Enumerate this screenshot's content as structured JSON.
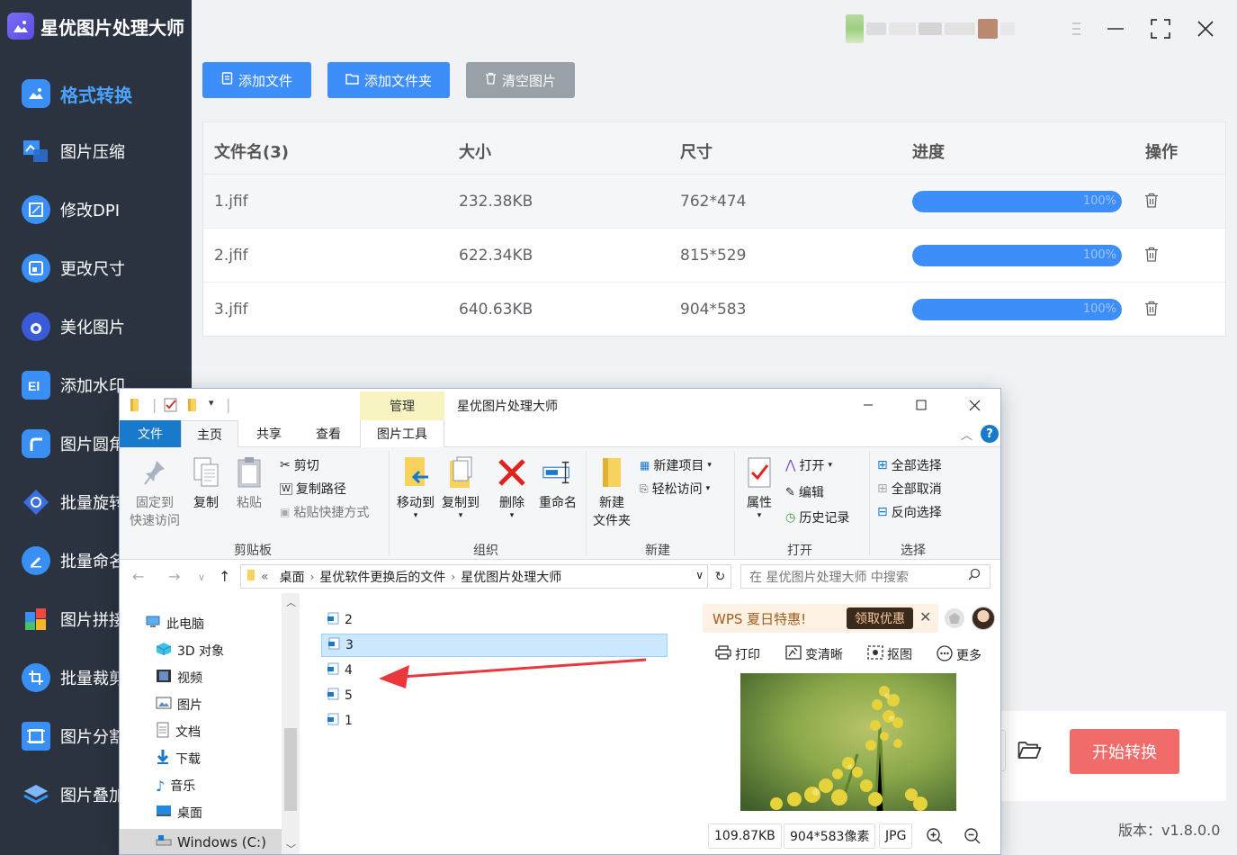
{
  "app": {
    "title": "星优图片处理大师",
    "version": "版本：v1.8.0.0",
    "start_label": "开始转换",
    "accent": "#3d8ef8",
    "start_color": "#f26b6b"
  },
  "sidebar": {
    "items": [
      {
        "label": "格式转换",
        "active": true
      },
      {
        "label": "图片压缩"
      },
      {
        "label": "修改DPI"
      },
      {
        "label": "更改尺寸"
      },
      {
        "label": "美化图片"
      },
      {
        "label": "添加水印"
      },
      {
        "label": "图片圆角"
      },
      {
        "label": "批量旋转"
      },
      {
        "label": "批量命名"
      },
      {
        "label": "图片拼接"
      },
      {
        "label": "批量裁剪"
      },
      {
        "label": "图片分割"
      },
      {
        "label": "图片叠加"
      }
    ]
  },
  "toolbar": {
    "add_file": "添加文件",
    "add_folder": "添加文件夹",
    "clear": "清空图片"
  },
  "table": {
    "headers": {
      "name": "文件名(3)",
      "size": "大小",
      "dims": "尺寸",
      "progress": "进度",
      "action": "操作"
    },
    "rows": [
      {
        "name": "1.jfif",
        "size": "232.38KB",
        "dims": "762*474",
        "progress": "100%",
        "progress_value": 1.0
      },
      {
        "name": "2.jfif",
        "size": "622.34KB",
        "dims": "815*529",
        "progress": "100%",
        "progress_value": 1.0
      },
      {
        "name": "3.jfif",
        "size": "640.63KB",
        "dims": "904*583",
        "progress": "100%",
        "progress_value": 1.0
      }
    ]
  },
  "explorer": {
    "title": "星优图片处理大师",
    "manage_tab": "管理",
    "tabs": {
      "file": "文件",
      "home": "主页",
      "share": "共享",
      "view": "查看",
      "picture_tools": "图片工具"
    },
    "ribbon": {
      "pin": [
        "固定到",
        "快速访问"
      ],
      "copy": "复制",
      "paste": "粘贴",
      "cut": "剪切",
      "copy_path": "复制路径",
      "paste_shortcut": "粘贴快捷方式",
      "clipboard": "剪贴板",
      "move_to": "移动到",
      "copy_to": "复制到",
      "delete": "删除",
      "rename": "重命名",
      "organize": "组织",
      "new_folder": [
        "新建",
        "文件夹"
      ],
      "new_item": "新建项目",
      "easy_access": "轻松访问",
      "new_group": "新建",
      "properties": "属性",
      "open": "打开",
      "edit": "编辑",
      "history": "历史记录",
      "open_group": "打开",
      "select_all": "全部选择",
      "select_none": "全部取消",
      "invert": "反向选择",
      "select_group": "选择"
    },
    "address": {
      "prefix": "«",
      "crumbs": [
        "桌面",
        "星优软件更换后的文件",
        "星优图片处理大师"
      ],
      "search_placeholder": "在 星优图片处理大师 中搜索"
    },
    "tree": [
      {
        "label": "此电脑",
        "icon": "computer-icon"
      },
      {
        "label": "3D 对象",
        "icon": "3d-objects-icon"
      },
      {
        "label": "视频",
        "icon": "video-icon"
      },
      {
        "label": "图片",
        "icon": "pictures-icon"
      },
      {
        "label": "文档",
        "icon": "documents-icon"
      },
      {
        "label": "下载",
        "icon": "download-icon"
      },
      {
        "label": "音乐",
        "icon": "music-icon"
      },
      {
        "label": "桌面",
        "icon": "desktop-icon"
      },
      {
        "label": "Windows (C:)",
        "icon": "drive-icon"
      }
    ],
    "files": [
      "2",
      "3",
      "4",
      "5",
      "1"
    ],
    "selected_file": "3",
    "preview": {
      "ad_text": "WPS 夏日特惠!",
      "ad_button": "领取优惠",
      "tools": [
        "打印",
        "变清晰",
        "抠图",
        "更多"
      ],
      "file_size": "109.87KB",
      "pixels": "904*583像素",
      "format": "JPG"
    }
  }
}
